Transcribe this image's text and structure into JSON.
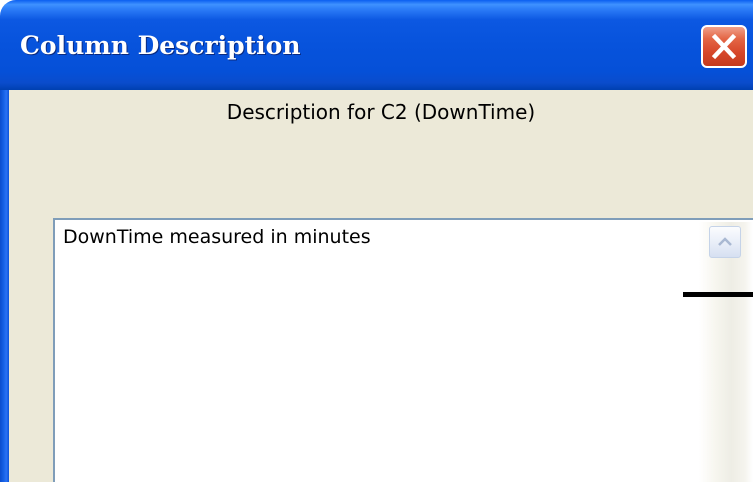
{
  "window": {
    "title": "Column Description",
    "colors": {
      "titlebar": "#0753dc",
      "client": "#ece9d8",
      "close_button": "#d7472a"
    }
  },
  "title_bar": {
    "close_icon": "close-icon"
  },
  "dialog": {
    "heading": "Description for C2 (DownTime)",
    "description_text": "DownTime measured in minutes"
  },
  "scrollbar": {
    "up_icon": "scroll-up-arrow-icon"
  }
}
